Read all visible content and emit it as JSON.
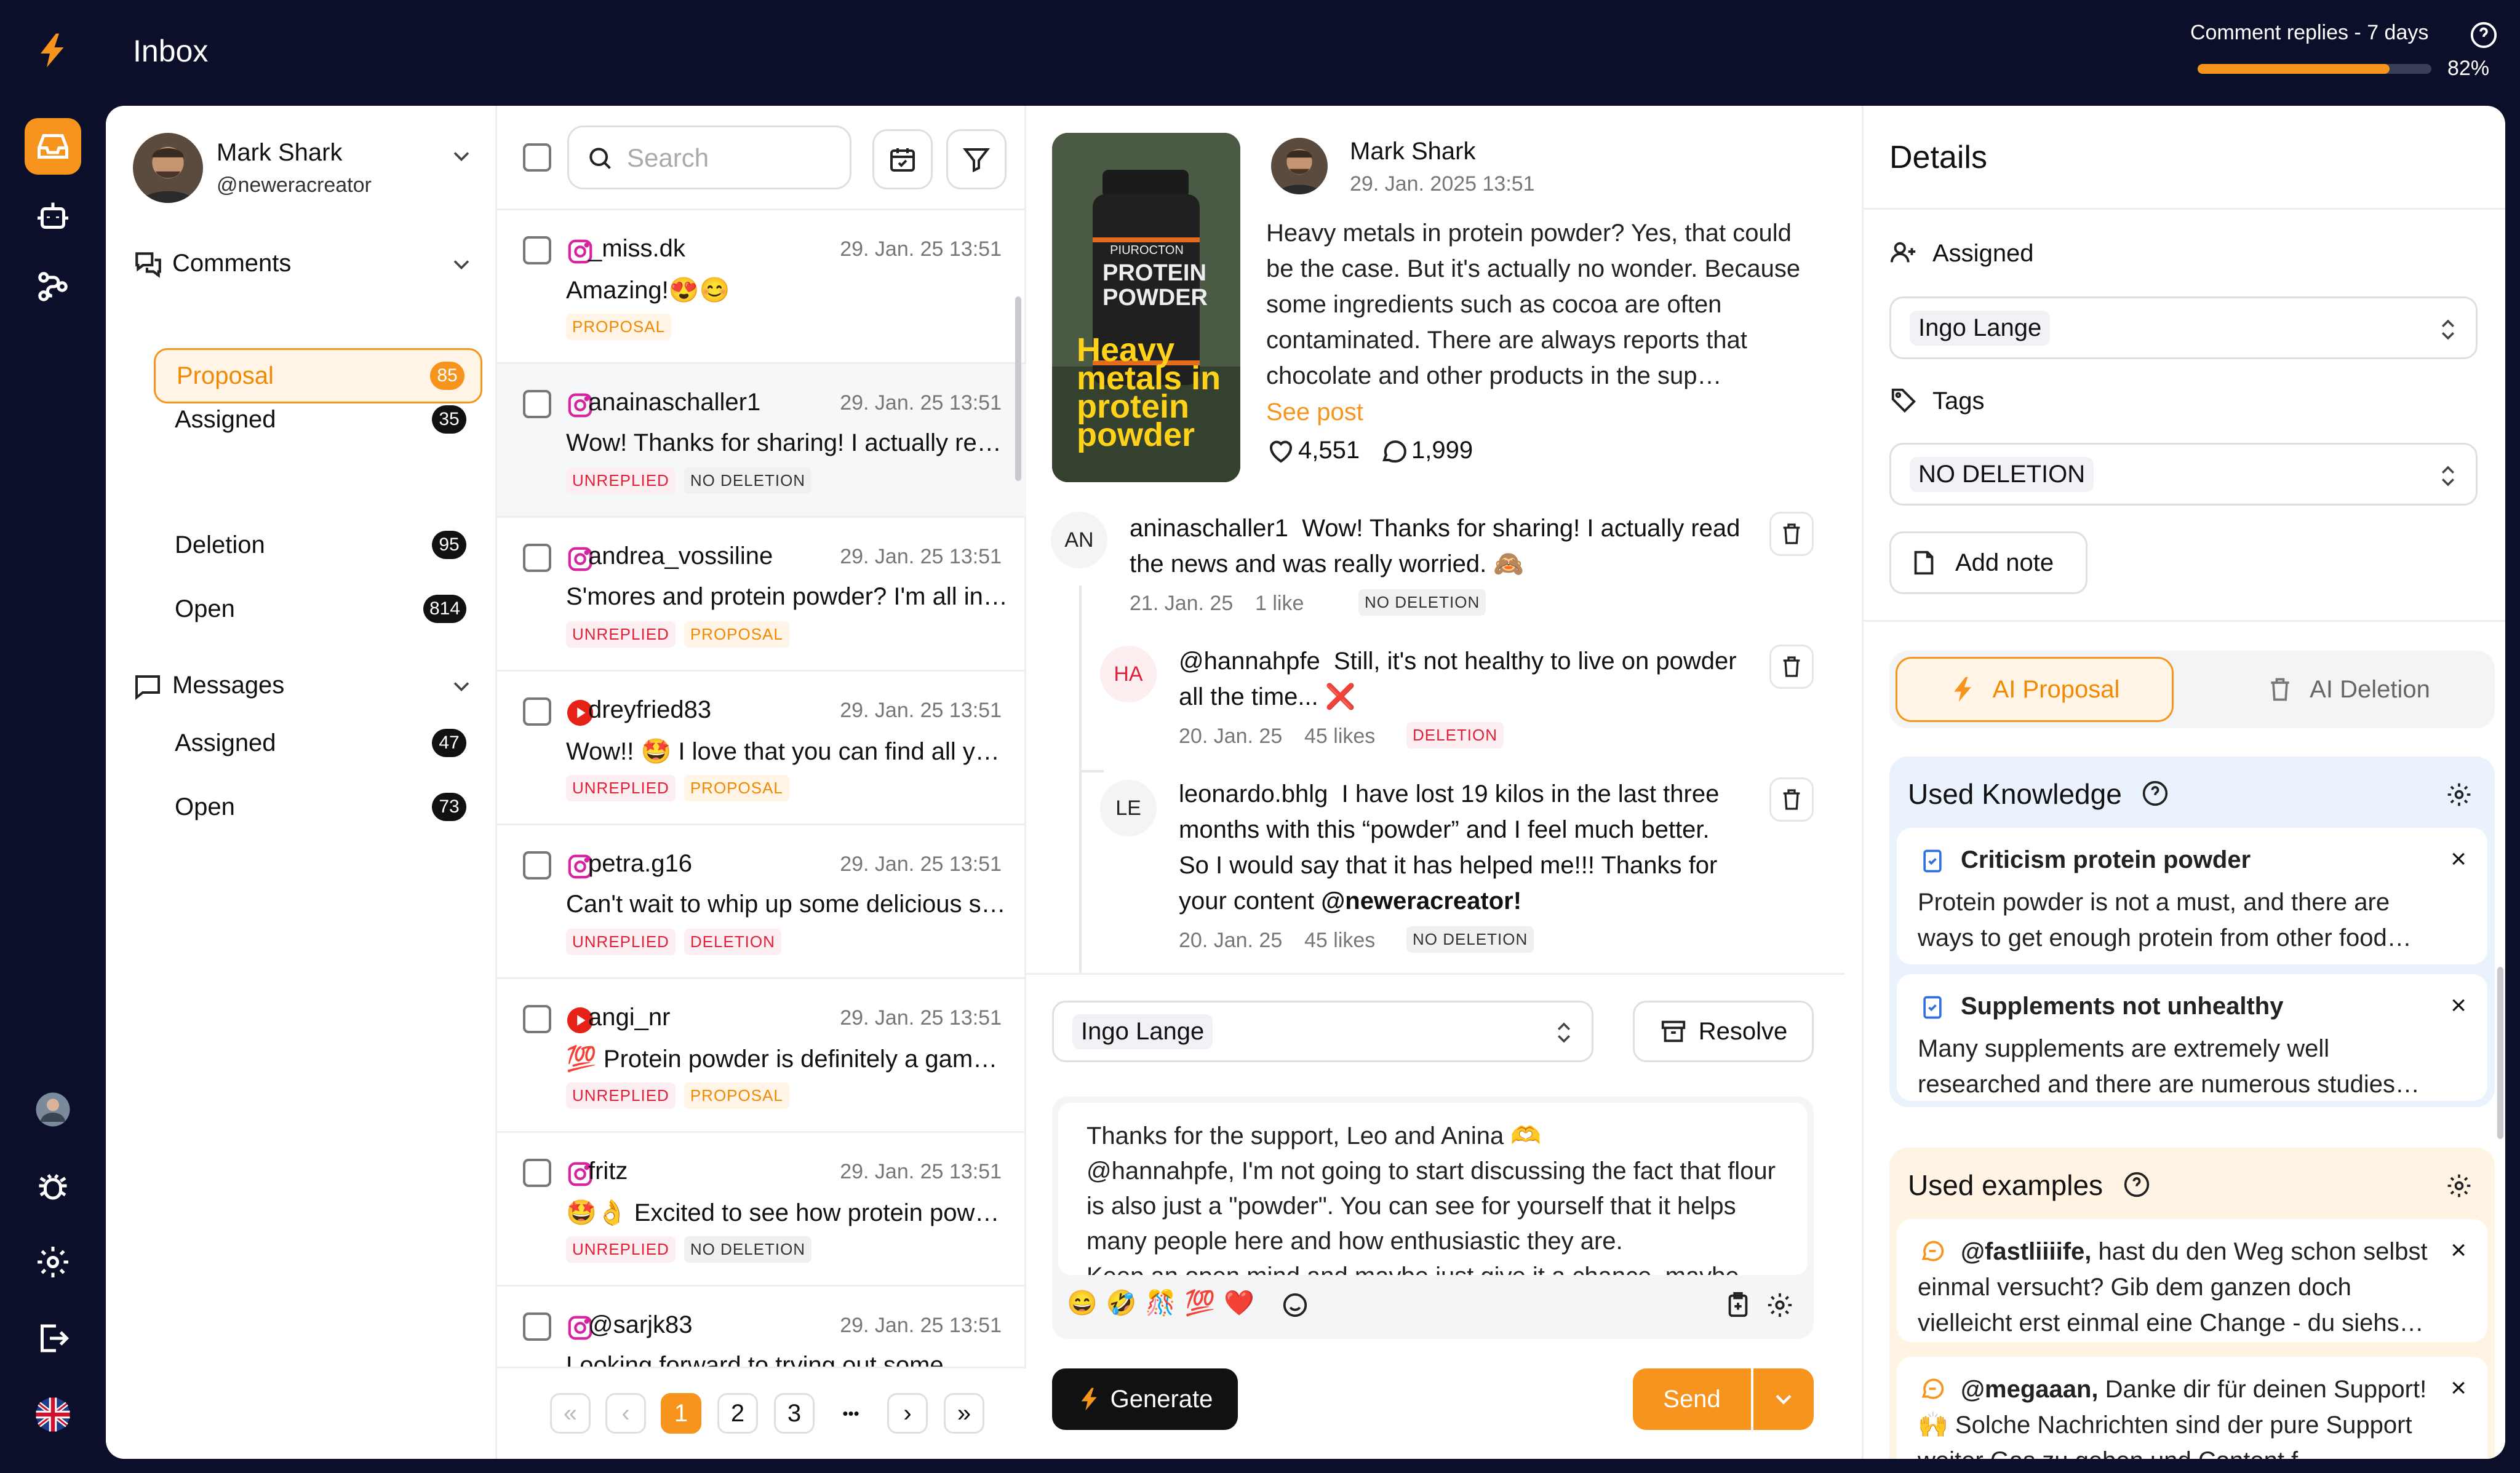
{
  "app": {
    "title": "Inbox",
    "accent": "#f7941d",
    "quota": {
      "label": "Comment replies - 7 days",
      "percent_text": "82%",
      "percent": 82
    }
  },
  "rail": {
    "icons": [
      "inbox-icon",
      "bot-icon",
      "workflow-icon",
      "user-avatar",
      "bug-icon",
      "gear-icon",
      "logout-icon",
      "uk-flag-icon"
    ]
  },
  "account": {
    "name": "Mark Shark",
    "handle": "@neweracreator"
  },
  "sidebar": {
    "comments": {
      "label": "Comments",
      "items": [
        {
          "label": "Assigned",
          "count": "35"
        },
        {
          "label": "Proposal",
          "count": "85"
        },
        {
          "label": "Deletion",
          "count": "95"
        },
        {
          "label": "Open",
          "count": "814"
        }
      ]
    },
    "messages": {
      "label": "Messages",
      "items": [
        {
          "label": "Assigned",
          "count": "47"
        },
        {
          "label": "Open",
          "count": "73"
        }
      ]
    }
  },
  "list": {
    "search_placeholder": "Search",
    "rows": [
      {
        "platform": "instagram",
        "name": "_miss.dk",
        "date": "29. Jan. 25  13:51",
        "message": "Amazing!😍😊",
        "tags": [
          {
            "text": "PROPOSAL",
            "style": "orange"
          }
        ]
      },
      {
        "platform": "instagram",
        "name": "anainaschaller1",
        "date": "29. Jan. 25  13:51",
        "message": "Wow! Thanks for sharing! I actually read the news",
        "tags": [
          {
            "text": "UNREPLIED",
            "style": "red"
          },
          {
            "text": "NO DELETION",
            "style": "gray"
          }
        ]
      },
      {
        "platform": "instagram",
        "name": "andrea_vossiline",
        "date": "29. Jan. 25  13:51",
        "message": "S'mores and protein powder? I'm all in for this",
        "tags": [
          {
            "text": "UNREPLIED",
            "style": "red"
          },
          {
            "text": "PROPOSAL",
            "style": "orange"
          }
        ]
      },
      {
        "platform": "youtube",
        "name": "dreyfried83",
        "date": "29. Jan. 25  13:51",
        "message": "Wow!! 🤩 I love that you can find all your stuff",
        "tags": [
          {
            "text": "UNREPLIED",
            "style": "red"
          },
          {
            "text": "PROPOSAL",
            "style": "orange"
          }
        ]
      },
      {
        "platform": "instagram",
        "name": "petra.g16",
        "date": "29. Jan. 25  13:51",
        "message": "Can't wait to whip up some delicious snacks",
        "tags": [
          {
            "text": "UNREPLIED",
            "style": "red"
          },
          {
            "text": "DELETION",
            "style": "red"
          }
        ]
      },
      {
        "platform": "youtube",
        "name": "angi_nr",
        "date": "29. Jan. 25  13:51",
        "message": "💯 Protein powder is definitely a game changer",
        "tags": [
          {
            "text": "UNREPLIED",
            "style": "red"
          },
          {
            "text": "PROPOSAL",
            "style": "orange"
          }
        ]
      },
      {
        "platform": "instagram",
        "name": "fritz",
        "date": "29. Jan. 25  13:51",
        "message": "🤩👌 Excited to see how protein powder helps",
        "tags": [
          {
            "text": "UNREPLIED",
            "style": "red"
          },
          {
            "text": "NO DELETION",
            "style": "gray"
          }
        ]
      },
      {
        "platform": "instagram",
        "name": "@sarjk83",
        "date": "29. Jan. 25  13:51",
        "message": "Looking forward to trying out some",
        "tags": []
      }
    ],
    "pagination": {
      "pages": [
        "1",
        "2",
        "3"
      ],
      "current": "1",
      "ellipsis": "•••"
    }
  },
  "post": {
    "author": "Mark Shark",
    "date": "29. Jan. 2025  13:51",
    "thumb_text": "Heavy metals in protein powder",
    "jar_text_1": "PIUROCTON",
    "jar_text_2": "PROTEIN POWDER",
    "body": "Heavy metals in protein powder? Yes, that could be the case. But it's actually no wonder. Because some ingredients such as cocoa are often contaminated. There are always reports that chocolate and other products in the sup…",
    "see_post": "See post",
    "likes": "4,551",
    "comments": "1,999"
  },
  "thread": [
    {
      "initials": "AN",
      "name": "aninaschaller1",
      "text": "Wow! Thanks for sharing! I actually read the news and was really worried. 🙈",
      "date": "21. Jan. 25",
      "likes": "1 like",
      "tag": "NO DELETION",
      "tag_style": "gray"
    },
    {
      "initials": "HA",
      "name": "@hannahpfe",
      "text": "Still, it's not healthy to live on powder all the time... ❌",
      "date": "20. Jan. 25",
      "likes": "45 likes",
      "tag": "DELETION",
      "tag_style": "red"
    },
    {
      "initials": "LE",
      "name": "leonardo.bhlg",
      "text": "I have lost 19 kilos in the last three months with this “powder” and I feel much better. So I would say that it has helped me!!! Thanks for your content ",
      "mention": "@neweracreator!",
      "date": "20. Jan. 25",
      "likes": "45 likes",
      "tag": "NO DELETION",
      "tag_style": "gray"
    }
  ],
  "composer": {
    "assignee": "Ingo Lange",
    "resolve": "Resolve",
    "reply": "Thanks for the support, Leo and Anina 🫶\n@hannahpfe, I'm not going to start discussing the fact that flour is also just a \"powder\". You can see for yourself that it helps many people here and how enthusiastic they are.\nKeep an open mind and maybe just give it a chance, maybe",
    "emojis": [
      "😄",
      "🤣",
      "🎊",
      "💯",
      "❤️"
    ],
    "generate": "Generate",
    "send": "Send"
  },
  "details": {
    "title": "Details",
    "assigned_label": "Assigned",
    "assigned_value": "Ingo Lange",
    "tags_label": "Tags",
    "tags_value": "NO DELETION",
    "add_note": "Add note",
    "tabs": [
      "AI Proposal",
      "AI Deletion"
    ],
    "knowledge": {
      "title": "Used Knowledge",
      "items": [
        {
          "title": "Criticism protein powder",
          "body": "Protein powder is not a must, and there are ways to get enough protein from other food…"
        },
        {
          "title": "Supplements not unhealthy",
          "body": "Many supplements are extremely well researched and there are numerous studies…"
        }
      ]
    },
    "examples": {
      "title": "Used examples",
      "items": [
        {
          "user": "@fastliiiife,",
          "body": " hast du den Weg schon selbst einmal versucht? Gib dem ganzen doch vielleicht erst einmal eine Change - du siehs…"
        },
        {
          "user": "@megaaan,",
          "body": " Danke dir für deinen Support! 🙌 Solche Nachrichten sind der pure Support weiter Gas zu geben und Content f…"
        }
      ]
    }
  }
}
